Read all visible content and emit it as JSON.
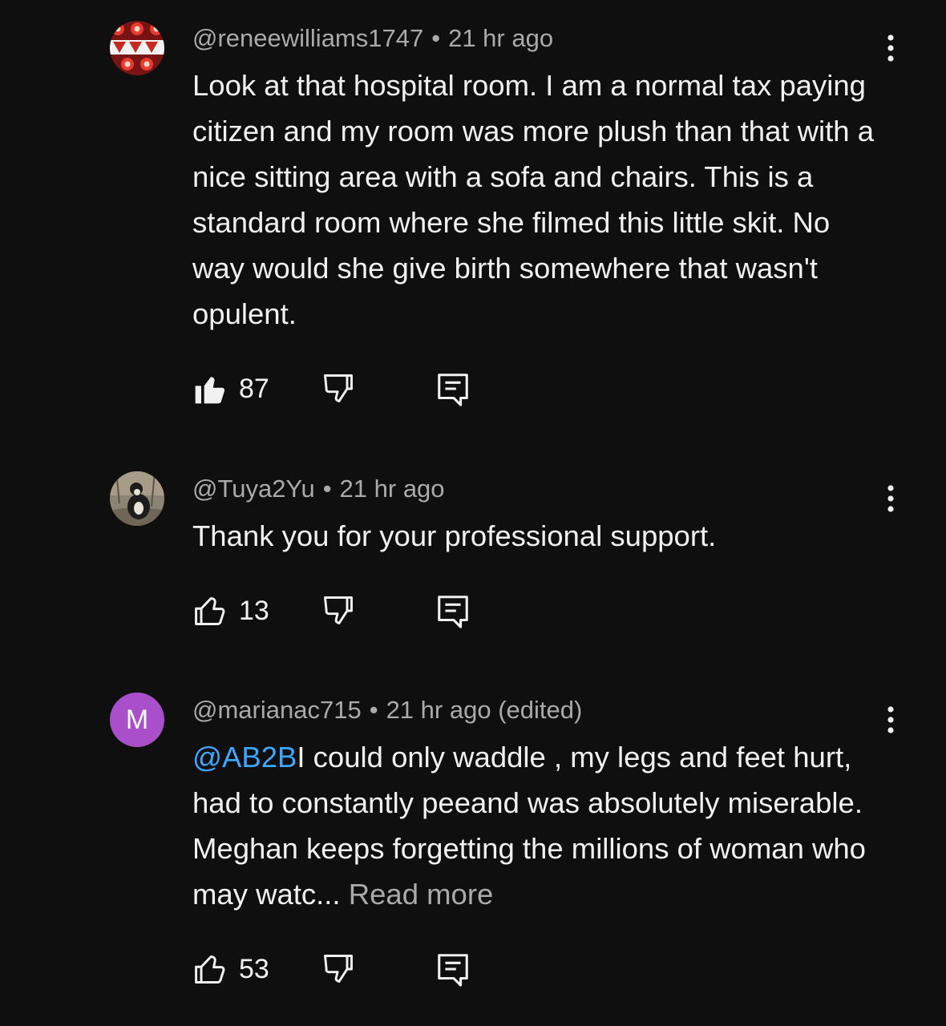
{
  "comments": [
    {
      "username": "@reneewilliams1747",
      "separator": "•",
      "time": "21 hr ago",
      "edited": "",
      "mention": "",
      "text": "Look at that hospital room. I am a normal tax paying citizen and my room was more plush than that with a nice sitting area with a sofa and chairs. This is a standard room where she filmed this little skit. No way would she give birth somewhere that wasn't opulent.",
      "read_more": "",
      "like_count": "87",
      "liked": true,
      "avatar_icon": "patterned-avatar"
    },
    {
      "username": "@Tuya2Yu",
      "separator": "•",
      "time": "21 hr ago",
      "edited": "",
      "mention": "",
      "text": "Thank you for your professional support.",
      "read_more": "",
      "like_count": "13",
      "liked": false,
      "avatar_icon": "dog-photo-avatar"
    },
    {
      "username": "@marianac715",
      "separator": "•",
      "time": "21 hr ago",
      "edited": "(edited)",
      "mention": "@AB2B",
      "text": "I could only waddle , my legs and feet hurt, had to constantly peeand was absolutely miserable. Meghan keeps forgetting the millions of woman who may watc...",
      "read_more": "Read more",
      "like_count": "53",
      "liked": false,
      "avatar_letter": "M",
      "avatar_color": "#a94fc9"
    }
  ],
  "colors": {
    "background": "#0f0f0f",
    "text": "#f1f1f1",
    "secondary": "#aaaaaa",
    "mention": "#3ea6ff"
  }
}
